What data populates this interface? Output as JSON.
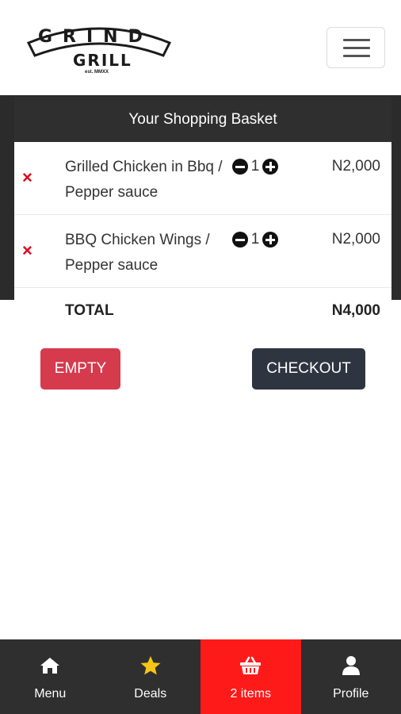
{
  "header": {
    "logo": {
      "line1": "GRIND",
      "line2": "GRILL",
      "tagline": "est. MMXX"
    },
    "menu_icon": "hamburger-icon"
  },
  "basket": {
    "title": "Your Shopping Basket",
    "items": [
      {
        "name": "Grilled Chicken in Bbq / Pepper sauce",
        "quantity": "1",
        "price": "N2,000"
      },
      {
        "name": "BBQ Chicken Wings / Pepper sauce",
        "quantity": "1",
        "price": "N2,000"
      }
    ],
    "remove_icon": "×",
    "total_label": "TOTAL",
    "total_value": "N4,000"
  },
  "actions": {
    "empty_label": "EMPTY",
    "checkout_label": "CHECKOUT"
  },
  "bottom_nav": [
    {
      "label": "Menu",
      "icon": "home-icon"
    },
    {
      "label": "Deals",
      "icon": "star-icon"
    },
    {
      "label": "2 items",
      "icon": "basket-icon",
      "active": true
    },
    {
      "label": "Profile",
      "icon": "user-icon"
    }
  ],
  "colors": {
    "accent_red": "#ff1a1a",
    "remove_red": "#e1001a",
    "empty_button": "#d63a4d",
    "checkout_button": "#2f3540",
    "dark_bar": "#2f2f2f",
    "star_yellow": "#f5c518"
  }
}
